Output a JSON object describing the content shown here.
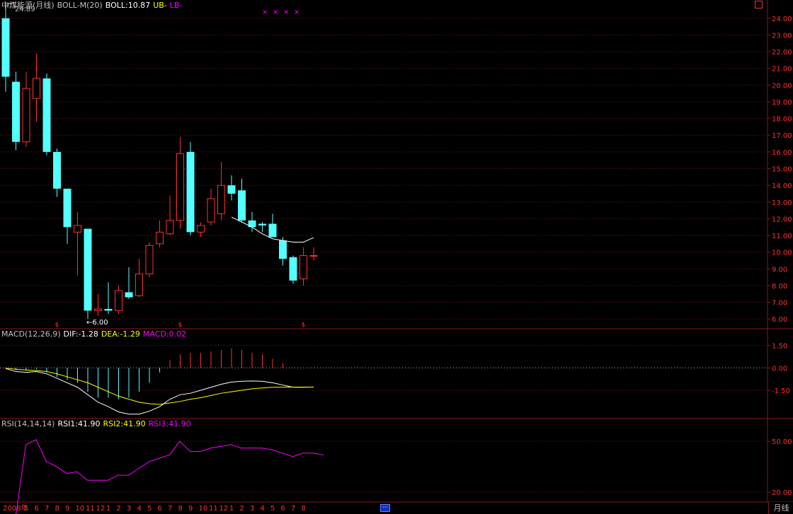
{
  "header": {
    "main": {
      "name": "中煤能源(月线)",
      "indicator": "BOLL-M(20)",
      "boll": "BOLL:10.87",
      "ub": "UB-",
      "lb": "LB-"
    },
    "macd": {
      "name": "MACD(12,26,9)",
      "dif": "DIF:-1.28",
      "dea": "DEA:-1.29",
      "macd": "MACD:0.02"
    },
    "rsi": {
      "name": "RSI(14,14,14)",
      "rsi1": "RSI1:41.90",
      "rsi2": "RSI2:41.90",
      "rsi3": "RSI3:41.90"
    }
  },
  "colors": {
    "up": "#ff3030",
    "down": "#54ffff",
    "grid": "#8a1a1a",
    "boll": "#ffffff",
    "dea": "#ffff00",
    "rsi": "#ff00ff"
  },
  "footer": {
    "period": "月线"
  },
  "chart_data": [
    {
      "type": "candlestick",
      "title": "中煤能源(月线)",
      "ylim": [
        5.5,
        24.5
      ],
      "yticks": [
        "24.00",
        "23.00",
        "22.00",
        "21.00",
        "20.00",
        "19.00",
        "18.00",
        "17.00",
        "16.00",
        "15.00",
        "14.00",
        "13.00",
        "12.00",
        "11.00",
        "10.00",
        "9.00",
        "8.00",
        "7.00",
        "6.00"
      ],
      "high_label": "24.89",
      "low_label": "←6.00",
      "markers": [
        "×",
        "×",
        "×",
        "×"
      ],
      "event_marks": [
        "$",
        "$",
        "$"
      ],
      "event_index": [
        5,
        17,
        29
      ],
      "x": [
        "2008年",
        "5",
        "6",
        "7",
        "8",
        "9",
        "10",
        "11",
        "12",
        "1",
        "2",
        "3",
        "4",
        "5",
        "6",
        "7",
        "8",
        "9",
        "10",
        "11",
        "12",
        "1",
        "2",
        "3",
        "4",
        "5",
        "6",
        "7",
        "8"
      ],
      "candles": [
        {
          "o": 24.0,
          "h": 24.89,
          "l": 19.6,
          "c": 20.5
        },
        {
          "o": 20.2,
          "h": 20.8,
          "l": 16.1,
          "c": 16.6
        },
        {
          "o": 16.6,
          "h": 20.8,
          "l": 16.3,
          "c": 19.8
        },
        {
          "o": 19.2,
          "h": 21.9,
          "l": 17.8,
          "c": 20.4
        },
        {
          "o": 20.4,
          "h": 20.7,
          "l": 15.8,
          "c": 16.0
        },
        {
          "o": 16.0,
          "h": 16.2,
          "l": 13.3,
          "c": 13.8
        },
        {
          "o": 13.8,
          "h": 13.8,
          "l": 10.5,
          "c": 11.5
        },
        {
          "o": 11.2,
          "h": 12.4,
          "l": 8.6,
          "c": 11.6
        },
        {
          "o": 11.4,
          "h": 11.4,
          "l": 6.0,
          "c": 6.5
        },
        {
          "o": 6.5,
          "h": 7.5,
          "l": 6.2,
          "c": 6.6
        },
        {
          "o": 6.6,
          "h": 8.2,
          "l": 6.3,
          "c": 6.5
        },
        {
          "o": 6.5,
          "h": 8.0,
          "l": 6.3,
          "c": 7.7
        },
        {
          "o": 7.6,
          "h": 9.1,
          "l": 7.2,
          "c": 7.3
        },
        {
          "o": 7.4,
          "h": 9.6,
          "l": 7.3,
          "c": 8.7
        },
        {
          "o": 8.7,
          "h": 10.6,
          "l": 8.5,
          "c": 10.4
        },
        {
          "o": 10.5,
          "h": 11.9,
          "l": 10.3,
          "c": 11.2
        },
        {
          "o": 11.1,
          "h": 13.4,
          "l": 11.0,
          "c": 11.9
        },
        {
          "o": 11.9,
          "h": 16.9,
          "l": 11.4,
          "c": 15.9
        },
        {
          "o": 16.0,
          "h": 16.6,
          "l": 11.0,
          "c": 11.2
        },
        {
          "o": 11.2,
          "h": 11.8,
          "l": 10.9,
          "c": 11.6
        },
        {
          "o": 11.8,
          "h": 13.8,
          "l": 11.6,
          "c": 13.2
        },
        {
          "o": 12.3,
          "h": 15.4,
          "l": 11.9,
          "c": 14.0
        },
        {
          "o": 14.0,
          "h": 14.6,
          "l": 13.1,
          "c": 13.5
        },
        {
          "o": 13.7,
          "h": 14.4,
          "l": 11.8,
          "c": 11.9
        },
        {
          "o": 11.9,
          "h": 12.4,
          "l": 11.2,
          "c": 11.5
        },
        {
          "o": 11.7,
          "h": 11.8,
          "l": 11.2,
          "c": 11.6
        },
        {
          "o": 11.7,
          "h": 12.3,
          "l": 10.9,
          "c": 10.9
        },
        {
          "o": 10.7,
          "h": 10.9,
          "l": 9.2,
          "c": 9.6
        },
        {
          "o": 9.7,
          "h": 9.8,
          "l": 8.1,
          "c": 8.3
        },
        {
          "o": 8.4,
          "h": 10.3,
          "l": 8.0,
          "c": 9.8
        },
        {
          "o": 9.8,
          "h": 10.3,
          "l": 9.5,
          "c": 9.8
        }
      ],
      "boll_mid": [
        {
          "i": 22,
          "v": 12.1
        },
        {
          "i": 23,
          "v": 11.8
        },
        {
          "i": 24,
          "v": 11.5
        },
        {
          "i": 25,
          "v": 11.1
        },
        {
          "i": 26,
          "v": 10.8
        },
        {
          "i": 27,
          "v": 10.7
        },
        {
          "i": 28,
          "v": 10.6
        },
        {
          "i": 29,
          "v": 10.6
        },
        {
          "i": 30,
          "v": 10.87
        }
      ]
    },
    {
      "type": "line",
      "title": "MACD(12,26,9)",
      "ylim": [
        -3.3,
        2.0
      ],
      "yticks": [
        "1.50",
        "0.00",
        "-1.50"
      ],
      "dif": [
        -0.05,
        -0.25,
        -0.3,
        -0.25,
        -0.4,
        -0.7,
        -1.0,
        -1.3,
        -1.8,
        -2.3,
        -2.6,
        -2.95,
        -3.1,
        -3.1,
        -2.9,
        -2.6,
        -2.1,
        -1.8,
        -1.7,
        -1.5,
        -1.3,
        -1.1,
        -0.95,
        -0.9,
        -0.88,
        -0.9,
        -1.0,
        -1.15,
        -1.3,
        -1.3,
        -1.28
      ],
      "dea": [
        -0.02,
        -0.1,
        -0.15,
        -0.18,
        -0.25,
        -0.4,
        -0.6,
        -0.8,
        -1.0,
        -1.3,
        -1.6,
        -1.9,
        -2.1,
        -2.3,
        -2.4,
        -2.45,
        -2.35,
        -2.25,
        -2.1,
        -2.0,
        -1.85,
        -1.7,
        -1.6,
        -1.5,
        -1.4,
        -1.35,
        -1.3,
        -1.29,
        -1.29,
        -1.29,
        -1.29
      ],
      "macd": [
        -0.03,
        -0.15,
        -0.15,
        -0.07,
        -0.3,
        -0.6,
        -0.8,
        -1.0,
        -1.6,
        -2.0,
        -2.0,
        -2.1,
        -2.0,
        -1.6,
        -1.0,
        -0.3,
        0.5,
        0.9,
        1.0,
        1.0,
        1.1,
        1.2,
        1.3,
        1.2,
        1.0,
        0.9,
        0.6,
        0.3,
        0.02,
        0.0,
        0.02
      ]
    },
    {
      "type": "line",
      "title": "RSI(14,14,14)",
      "ylim": [
        15,
        58
      ],
      "yticks": [
        "50.00",
        "20.00"
      ],
      "rsi": [
        5,
        48,
        51,
        38,
        35,
        31,
        32,
        27,
        27,
        27,
        30,
        30,
        34,
        38,
        40,
        42,
        50,
        44,
        44,
        46,
        47,
        48,
        46,
        46,
        46,
        45,
        43,
        41,
        43,
        43,
        41.9
      ]
    }
  ]
}
